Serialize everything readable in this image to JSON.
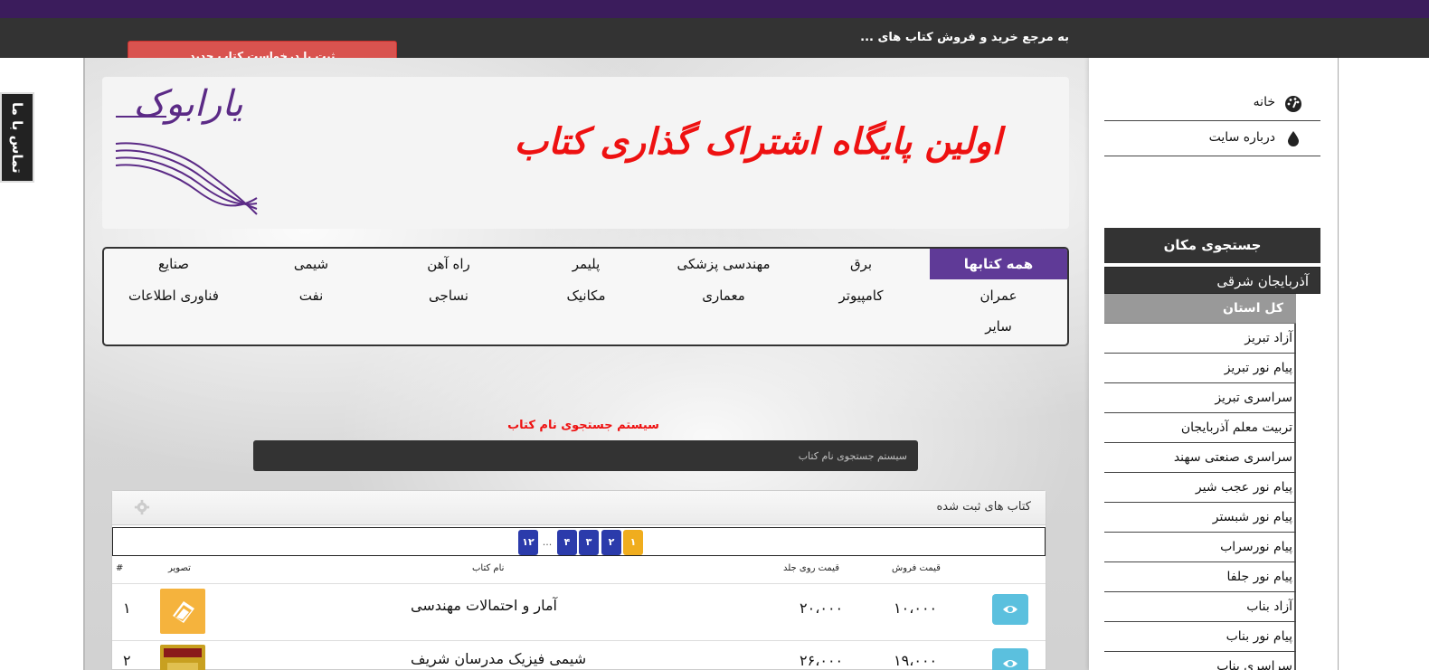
{
  "header": {
    "tagline": "به مرجع خرید و فروش کتاب های ...",
    "add_button": "ثبت یا درخواست کتاب جدید",
    "contact_tab": "تماس با ما"
  },
  "banner": {
    "title": "اولین پایگاه اشتراک گذاری کتاب",
    "logo_text": "یارابوک"
  },
  "categories": [
    "همه کتابها",
    "برق",
    "مهندسی پزشکی",
    "پلیمر",
    "راه آهن",
    "شیمی",
    "صنایع",
    "عمران",
    "کامپیوتر",
    "معماری",
    "مکانیک",
    "نساجی",
    "نفت",
    "فناوری اطلاعات",
    "سایر"
  ],
  "search": {
    "title": "سیستم جستجوی نام کتاب",
    "placeholder": "سیستم جستجوی نام کتاب"
  },
  "books_panel": {
    "title": "کتاب های ثبت شده",
    "pager": [
      "۱",
      "۲",
      "۳",
      "۴",
      "...",
      "۱۲"
    ],
    "columns": {
      "num": "#",
      "image": "تصویر",
      "name": "نام کتاب",
      "cover_price": "قیمت روی جلد",
      "sale_price": "قیمت فروش"
    },
    "rows": [
      {
        "num": "۱",
        "name": "آمار و احتمالات مهندسی",
        "cover_price": "۲۰،۰۰۰",
        "sale_price": "۱۰،۰۰۰"
      },
      {
        "num": "۲",
        "name": "شیمی فیزیک مدرسان شریف",
        "cover_price": "۲۶،۰۰۰",
        "sale_price": "۱۹،۰۰۰"
      }
    ]
  },
  "sidebar": {
    "nav": [
      {
        "label": "خانه",
        "icon": "dashboard-icon"
      },
      {
        "label": "درباره سایت",
        "icon": "drop-icon"
      }
    ],
    "location_title": "جستجوی مکان",
    "province": "آذربایجان شرقی",
    "cities": [
      "کل استان",
      "آزاد  تبریز",
      "پیام نور تبریز",
      "سراسری تبریز",
      "تربیت معلم آذربایجان",
      "سراسری صنعتی سهند",
      "پیام نور عجب شیر",
      "پیام نور شبستر",
      "پیام نورسراب",
      "پیام نور جلفا",
      "آزاد بناب",
      "پیام نور بناب",
      "سراسری بناب"
    ]
  },
  "colors": {
    "accent_purple": "#5f3a97",
    "add_button_red": "#d9534f",
    "banner_title_red": "#ee1111",
    "pager_blue": "#2b3bab",
    "pager_active": "#f0ad1e",
    "view_button": "#5bc0de"
  }
}
